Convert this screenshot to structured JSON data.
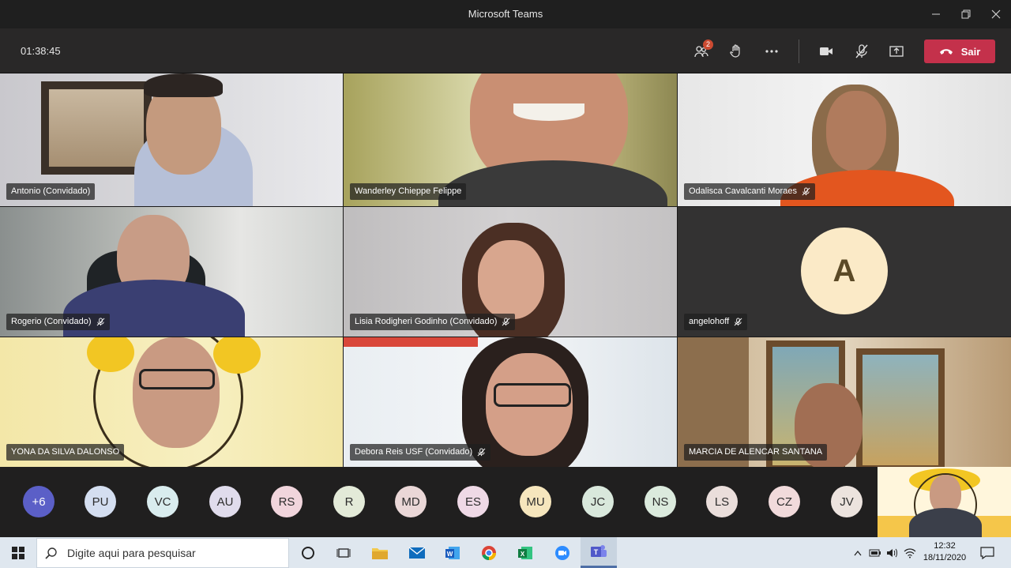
{
  "window": {
    "title": "Microsoft Teams",
    "controls": {
      "minimize": "minimize-icon",
      "restore": "restore-icon",
      "close": "close-icon"
    }
  },
  "toolbar": {
    "timer": "01:38:45",
    "participants_badge": "2",
    "leave_label": "Sair",
    "leave_color": "#c4314b"
  },
  "tiles": [
    {
      "name": "Antonio (Convidado)",
      "muted": false
    },
    {
      "name": "Wanderley Chieppe Felippe",
      "muted": false
    },
    {
      "name": "Odalisca Cavalcanti Moraes",
      "muted": true
    },
    {
      "name": "Rogerio (Convidado)",
      "muted": true
    },
    {
      "name": "Lisia Rodigheri Godinho (Convidado)",
      "muted": true
    },
    {
      "name": "angelohoff",
      "muted": true,
      "avatar_letter": "A"
    },
    {
      "name": "YONA DA SILVA DALONSO",
      "muted": false
    },
    {
      "name": "Debora Reis USF (Convidado)",
      "muted": true
    },
    {
      "name": "MARCIA DE ALENCAR SANTANA",
      "muted": false
    }
  ],
  "strip": {
    "overflow": "+6",
    "avatars": [
      "PU",
      "VC",
      "AU",
      "RS",
      "R",
      "MD",
      "ES",
      "MU",
      "JC",
      "NS",
      "LS",
      "CZ",
      "JV"
    ]
  },
  "taskbar": {
    "search_placeholder": "Digite aqui para pesquisar",
    "time": "12:32",
    "date": "18/11/2020"
  }
}
